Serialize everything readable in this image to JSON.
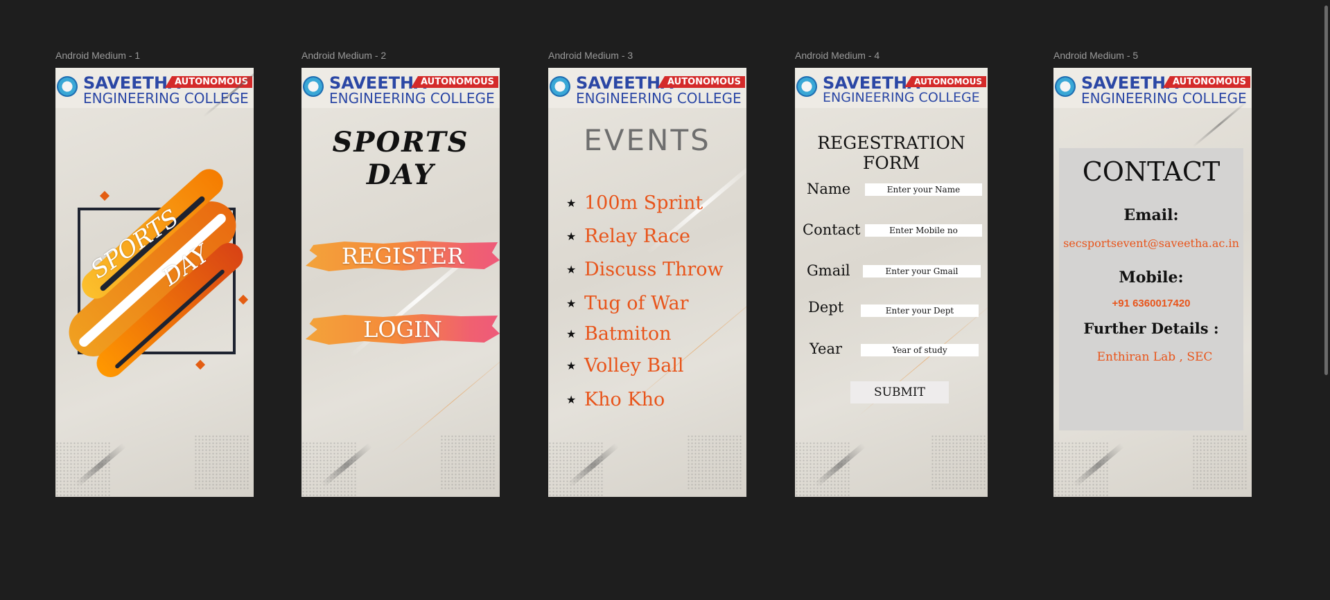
{
  "canvas": {
    "background": "#1e1e1e"
  },
  "college": {
    "name_line1": "SAVEETHA",
    "badge": "AUTONOMOUS",
    "name_line2": "ENGINEERING COLLEGE",
    "brand_color": "#2b47a5",
    "badge_color": "#d42a2a"
  },
  "frames": [
    {
      "label": "Android Medium - 1"
    },
    {
      "label": "Android Medium - 2"
    },
    {
      "label": "Android Medium - 3"
    },
    {
      "label": "Android Medium - 4"
    },
    {
      "label": "Android Medium - 5"
    }
  ],
  "splash": {
    "word1": "SPORTS",
    "word2": "DAY"
  },
  "home": {
    "title": "SPORTS DAY",
    "register_label": "REGISTER",
    "login_label": "LOGIN"
  },
  "events": {
    "title": "EVENTS",
    "accent_color": "#e8541a",
    "items": [
      {
        "bullet": "★",
        "name": "100m Sprint"
      },
      {
        "bullet": "★",
        "name": "Relay Race"
      },
      {
        "bullet": "★",
        "name": "Discuss Throw"
      },
      {
        "bullet": "★",
        "name": "Tug of War"
      },
      {
        "bullet": "★",
        "name": "Batmiton"
      },
      {
        "bullet": "★",
        "name": "Volley Ball"
      },
      {
        "bullet": "★",
        "name": "Kho Kho"
      }
    ]
  },
  "form": {
    "title": "REGESTRATION FORM",
    "fields": [
      {
        "label": "Name",
        "placeholder": "Enter your Name"
      },
      {
        "label": "Contact",
        "placeholder": "Enter Mobile no"
      },
      {
        "label": "Gmail",
        "placeholder": "Enter your Gmail"
      },
      {
        "label": "Dept",
        "placeholder": "Enter your Dept"
      },
      {
        "label": "Year",
        "placeholder": "Year of study"
      }
    ],
    "submit_label": "SUBMIT"
  },
  "contact": {
    "title": "CONTACT",
    "email_label": "Email:",
    "email": "secsportsevent@saveetha.ac.in",
    "mobile_label": "Mobile:",
    "mobile": "+91 6360017420",
    "details_label": "Further Details :",
    "details": "Enthiran Lab , SEC",
    "accent_color": "#e8541a"
  }
}
